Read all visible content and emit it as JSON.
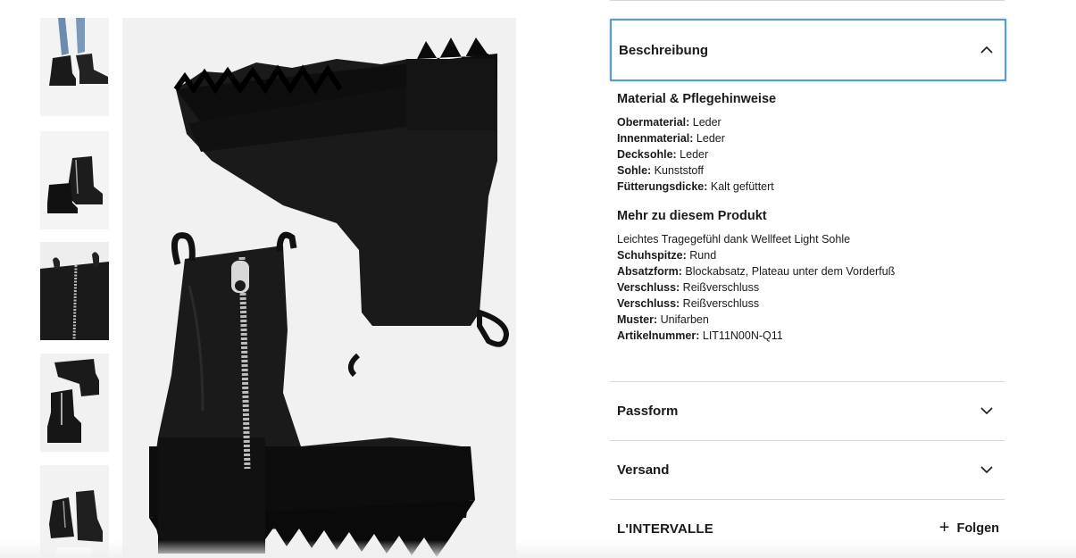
{
  "gallery": {
    "thumbnails": [
      {
        "name": "thumb-boots-worn",
        "active": false
      },
      {
        "name": "thumb-boot-side",
        "active": false
      },
      {
        "name": "thumb-boot-zipper-detail",
        "active": false
      },
      {
        "name": "thumb-boots-pair-top",
        "active": true
      },
      {
        "name": "thumb-boots-front",
        "active": false
      }
    ]
  },
  "accordion": {
    "description": {
      "title": "Beschreibung",
      "expanded": true,
      "icon": "chevron-up-icon"
    },
    "material": {
      "title": "Material & Pflegehinweise",
      "rows": [
        {
          "label": "Obermaterial:",
          "value": " Leder"
        },
        {
          "label": "Innenmaterial:",
          "value": " Leder"
        },
        {
          "label": "Decksohle:",
          "value": " Leder"
        },
        {
          "label": "Sohle:",
          "value": " Kunststoff"
        },
        {
          "label": "Fütterungsdicke:",
          "value": " Kalt gefüttert"
        }
      ]
    },
    "more": {
      "title": "Mehr zu diesem Produkt",
      "intro": "Leichtes Tragegefühl dank Wellfeet Light Sohle",
      "rows": [
        {
          "label": "Schuhspitze:",
          "value": " Rund"
        },
        {
          "label": "Absatzform:",
          "value": " Blockabsatz, Plateau unter dem Vorderfuß"
        },
        {
          "label": "Verschluss:",
          "value": " Reißverschluss"
        },
        {
          "label": "Verschluss:",
          "value": " Reißverschluss"
        },
        {
          "label": "Muster:",
          "value": " Unifarben"
        },
        {
          "label": "Artikelnummer:",
          "value": " LIT11N00N-Q11"
        }
      ]
    },
    "fit": {
      "title": "Passform",
      "expanded": false,
      "icon": "chevron-down-icon"
    },
    "shipping": {
      "title": "Versand",
      "expanded": false,
      "icon": "chevron-down-icon"
    }
  },
  "brand": {
    "name": "L'INTERVALLE",
    "follow_icon": "plus-icon",
    "follow_label": "Folgen"
  },
  "colors": {
    "focus_ring": "#5b9bd5",
    "text": "#1a1a1a",
    "divider": "#d6d6d6"
  }
}
